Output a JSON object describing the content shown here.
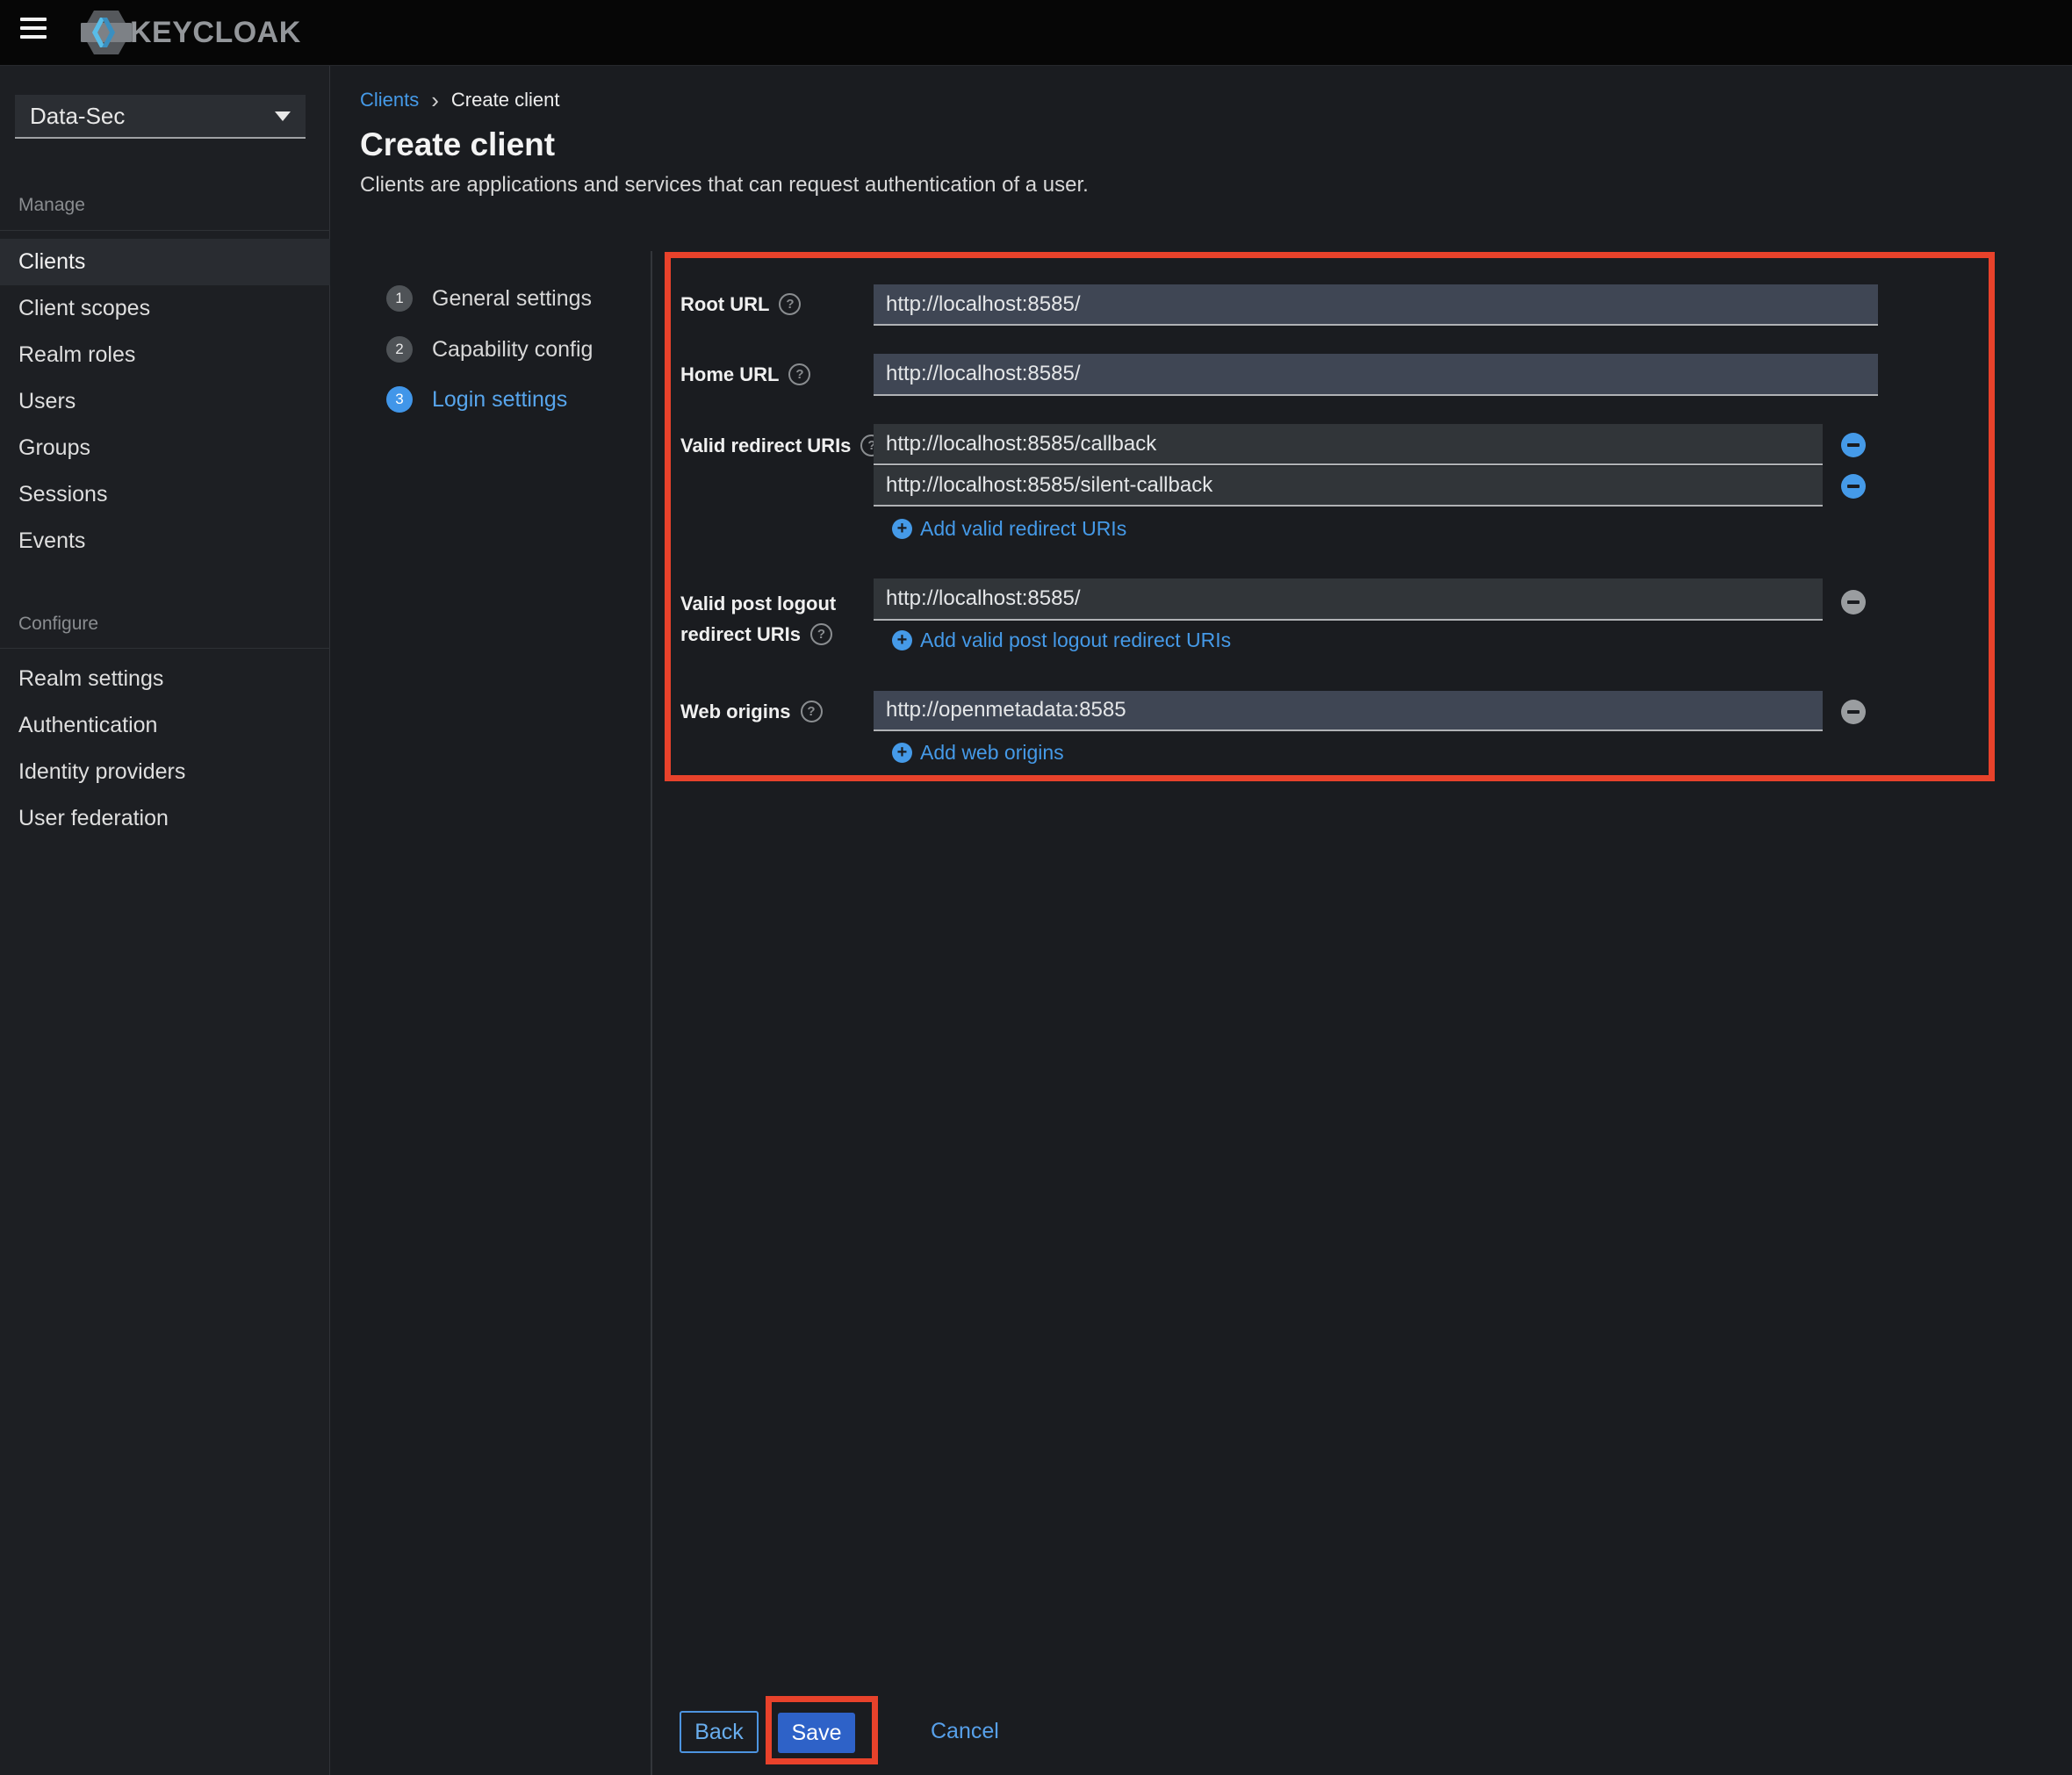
{
  "topbar": {
    "logo_text": "KEYCLOAK"
  },
  "sidebar": {
    "realm": "Data-Sec",
    "sections": [
      {
        "label": "Manage",
        "items": [
          "Clients",
          "Client scopes",
          "Realm roles",
          "Users",
          "Groups",
          "Sessions",
          "Events"
        ],
        "active_item": "Clients"
      },
      {
        "label": "Configure",
        "items": [
          "Realm settings",
          "Authentication",
          "Identity providers",
          "User federation"
        ]
      }
    ]
  },
  "breadcrumb": {
    "parent": "Clients",
    "current": "Create client"
  },
  "page": {
    "title": "Create client",
    "description": "Clients are applications and services that can request authentication of a user."
  },
  "wizard": {
    "steps": [
      {
        "number": "1",
        "label": "General settings"
      },
      {
        "number": "2",
        "label": "Capability config"
      },
      {
        "number": "3",
        "label": "Login settings",
        "active": true
      }
    ]
  },
  "form": {
    "root_url": {
      "label": "Root URL",
      "value": "http://localhost:8585/"
    },
    "home_url": {
      "label": "Home URL",
      "value": "http://localhost:8585/"
    },
    "redirect_uris": {
      "label": "Valid redirect URIs",
      "values": [
        "http://localhost:8585/callback",
        "http://localhost:8585/silent-callback"
      ],
      "add_label": "Add valid redirect URIs"
    },
    "post_logout": {
      "label_line1": "Valid post logout",
      "label_line2": "redirect URIs",
      "values": [
        "http://localhost:8585/"
      ],
      "add_label": "Add valid post logout redirect URIs"
    },
    "web_origins": {
      "label": "Web origins",
      "values": [
        "http://openmetadata:8585"
      ],
      "add_label": "Add web origins"
    }
  },
  "footer": {
    "back": "Back",
    "save": "Save",
    "cancel": "Cancel"
  },
  "icons": {
    "question": "?",
    "plus": "+",
    "breadcrumb_separator": "›"
  },
  "colors": {
    "annotation": "#e8422b",
    "primary_button": "#2e62c8",
    "link_blue": "#459ae8",
    "step_active": "#4196e9"
  }
}
